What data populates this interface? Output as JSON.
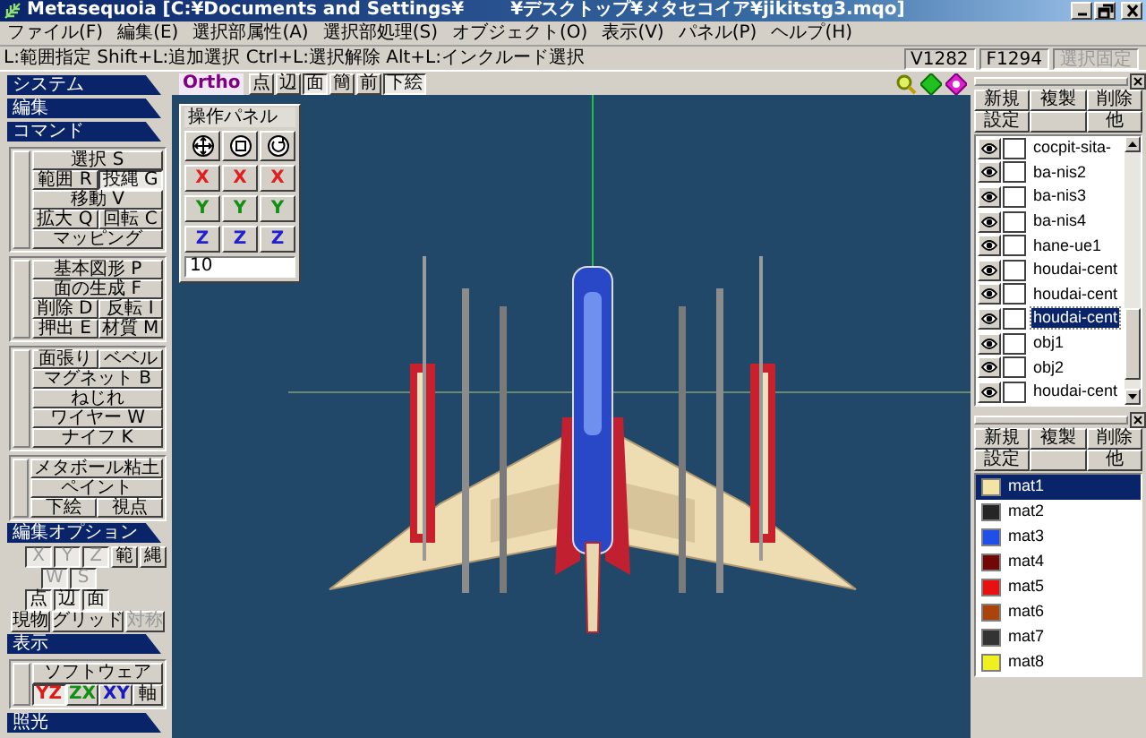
{
  "window": {
    "title_parts": [
      "Metasequoia [C:¥Documents and Settings¥",
      "¥デスクトップ¥メタセコイア¥jikitstg3.mqo]"
    ]
  },
  "menu": [
    "ファイル(F)",
    "編集(E)",
    "選択部属性(A)",
    "選択部処理(S)",
    "オブジェクト(O)",
    "表示(V)",
    "パネル(P)",
    "ヘルプ(H)"
  ],
  "status_bar": {
    "hint": "L:範囲指定 Shift+L:追加選択 Ctrl+L:選択解除 Alt+L:インクルード選択",
    "vertices": "V1282",
    "faces": "F1294",
    "lock": {
      "label": "選択固定",
      "disabled": true
    }
  },
  "left_panel": {
    "sections": [
      {
        "title": "システム"
      },
      {
        "title": "編集"
      },
      {
        "title": "コマンド",
        "groups": [
          [
            [
              {
                "label": "選択 S",
                "pressed": false
              }
            ],
            [
              {
                "label": "範囲 R",
                "pressed": false
              },
              {
                "label": "投縄 G",
                "pressed": true
              }
            ],
            [
              {
                "label": "移動 V",
                "pressed": false
              }
            ],
            [
              {
                "label": "拡大 Q",
                "pressed": false
              },
              {
                "label": "回転 C",
                "pressed": false
              }
            ],
            [
              {
                "label": "マッピング",
                "pressed": false
              }
            ]
          ],
          [
            [
              {
                "label": "基本図形 P",
                "pressed": false
              }
            ],
            [
              {
                "label": "面の生成 F",
                "pressed": false
              }
            ],
            [
              {
                "label": "削除 D",
                "pressed": false
              },
              {
                "label": "反転 I",
                "pressed": false
              }
            ],
            [
              {
                "label": "押出 E",
                "pressed": false
              },
              {
                "label": "材質 M",
                "pressed": false
              }
            ]
          ],
          [
            [
              {
                "label": "面張り",
                "pressed": false
              },
              {
                "label": "ベベル",
                "pressed": false
              }
            ],
            [
              {
                "label": "マグネット B",
                "pressed": false
              }
            ],
            [
              {
                "label": "ねじれ",
                "pressed": false
              }
            ],
            [
              {
                "label": "ワイヤー W",
                "pressed": false
              }
            ],
            [
              {
                "label": "ナイフ K",
                "pressed": false
              }
            ]
          ],
          [
            [
              {
                "label": "メタボール粘土",
                "pressed": false
              }
            ],
            [
              {
                "label": "ペイント",
                "pressed": false
              }
            ],
            [
              {
                "label": "下絵",
                "pressed": false
              },
              {
                "label": "視点",
                "pressed": false
              }
            ]
          ]
        ]
      },
      {
        "title": "編集オプション",
        "rows": [
          [
            {
              "label": "X",
              "pressed": true,
              "disabled": true
            },
            {
              "label": "Y",
              "pressed": true,
              "disabled": true
            },
            {
              "label": "Z",
              "pressed": true,
              "disabled": true
            },
            {
              "label": "範",
              "pressed": false,
              "disabled": false
            },
            {
              "label": "縄",
              "pressed": false,
              "disabled": false
            }
          ],
          [
            {
              "label": "W",
              "pressed": true,
              "disabled": true
            },
            {
              "label": "S",
              "pressed": true,
              "disabled": true
            }
          ],
          [
            {
              "label": "点",
              "pressed": true,
              "disabled": false
            },
            {
              "label": "辺",
              "pressed": true,
              "disabled": false
            },
            {
              "label": "面",
              "pressed": true,
              "disabled": false
            }
          ]
        ],
        "snap_buttons": [
          {
            "label": "現物",
            "pressed": false,
            "disabled": false
          },
          {
            "label": "グリッド",
            "pressed": false,
            "disabled": false
          },
          {
            "label": "対称",
            "pressed": false,
            "disabled": true
          }
        ]
      },
      {
        "title": "表示",
        "groups": [
          [
            [
              {
                "label": "ソフトウェア",
                "pressed": false
              }
            ],
            [
              {
                "label": "YZ",
                "pressed": true,
                "color": "#e01818"
              },
              {
                "label": "ZX",
                "pressed": false,
                "color": "#109010"
              },
              {
                "label": "XY",
                "pressed": false,
                "color": "#1818c0"
              },
              {
                "label": "軸",
                "pressed": false
              }
            ]
          ]
        ]
      },
      {
        "title": "照光"
      }
    ]
  },
  "viewport": {
    "projection": "Ortho",
    "buttons": [
      {
        "label": "点",
        "pressed": false
      },
      {
        "label": "辺",
        "pressed": false
      },
      {
        "label": "面",
        "pressed": true
      },
      {
        "label": "簡",
        "pressed": false
      },
      {
        "label": "前",
        "pressed": false
      },
      {
        "label": "下絵",
        "pressed": true
      }
    ],
    "operation_panel": {
      "title": "操作パネル",
      "axis_rows": [
        {
          "color": "#e02020",
          "labels": [
            "X",
            "X",
            "X"
          ]
        },
        {
          "color": "#109010",
          "labels": [
            "Y",
            "Y",
            "Y"
          ]
        },
        {
          "color": "#2020d0",
          "labels": [
            "Z",
            "Z",
            "Z"
          ]
        }
      ],
      "value": "10"
    }
  },
  "object_panel": {
    "buttons_top": [
      "新規",
      "複製",
      "削除"
    ],
    "buttons_bottom": [
      "設定",
      "他"
    ],
    "objects": [
      {
        "name": "cocpit-sita-",
        "selected": false,
        "locked": false
      },
      {
        "name": "ba-nis2",
        "selected": false,
        "locked": false
      },
      {
        "name": "ba-nis3",
        "selected": false,
        "locked": false
      },
      {
        "name": "ba-nis4",
        "selected": false,
        "locked": false
      },
      {
        "name": "hane-ue1",
        "selected": false,
        "locked": false
      },
      {
        "name": "houdai-cent",
        "selected": false,
        "locked": false
      },
      {
        "name": "houdai-cent",
        "selected": false,
        "locked": false
      },
      {
        "name": "houdai-cent",
        "selected": true,
        "locked": false
      },
      {
        "name": "obj1",
        "selected": false,
        "locked": false
      },
      {
        "name": "obj2",
        "selected": false,
        "locked": false
      },
      {
        "name": "houdai-cent",
        "selected": false,
        "locked": false
      }
    ]
  },
  "material_panel": {
    "buttons_top": [
      "新規",
      "複製",
      "削除"
    ],
    "buttons_bottom": [
      "設定",
      "他"
    ],
    "materials": [
      {
        "name": "mat1",
        "color": "#f3e3a4",
        "selected": true
      },
      {
        "name": "mat2",
        "color": "#252525",
        "selected": false
      },
      {
        "name": "mat3",
        "color": "#1f4fe8",
        "selected": false
      },
      {
        "name": "mat4",
        "color": "#700808",
        "selected": false
      },
      {
        "name": "mat5",
        "color": "#e81010",
        "selected": false
      },
      {
        "name": "mat6",
        "color": "#a8440c",
        "selected": false
      },
      {
        "name": "mat7",
        "color": "#333333",
        "selected": false
      },
      {
        "name": "mat8",
        "color": "#f0f020",
        "selected": false
      }
    ]
  }
}
